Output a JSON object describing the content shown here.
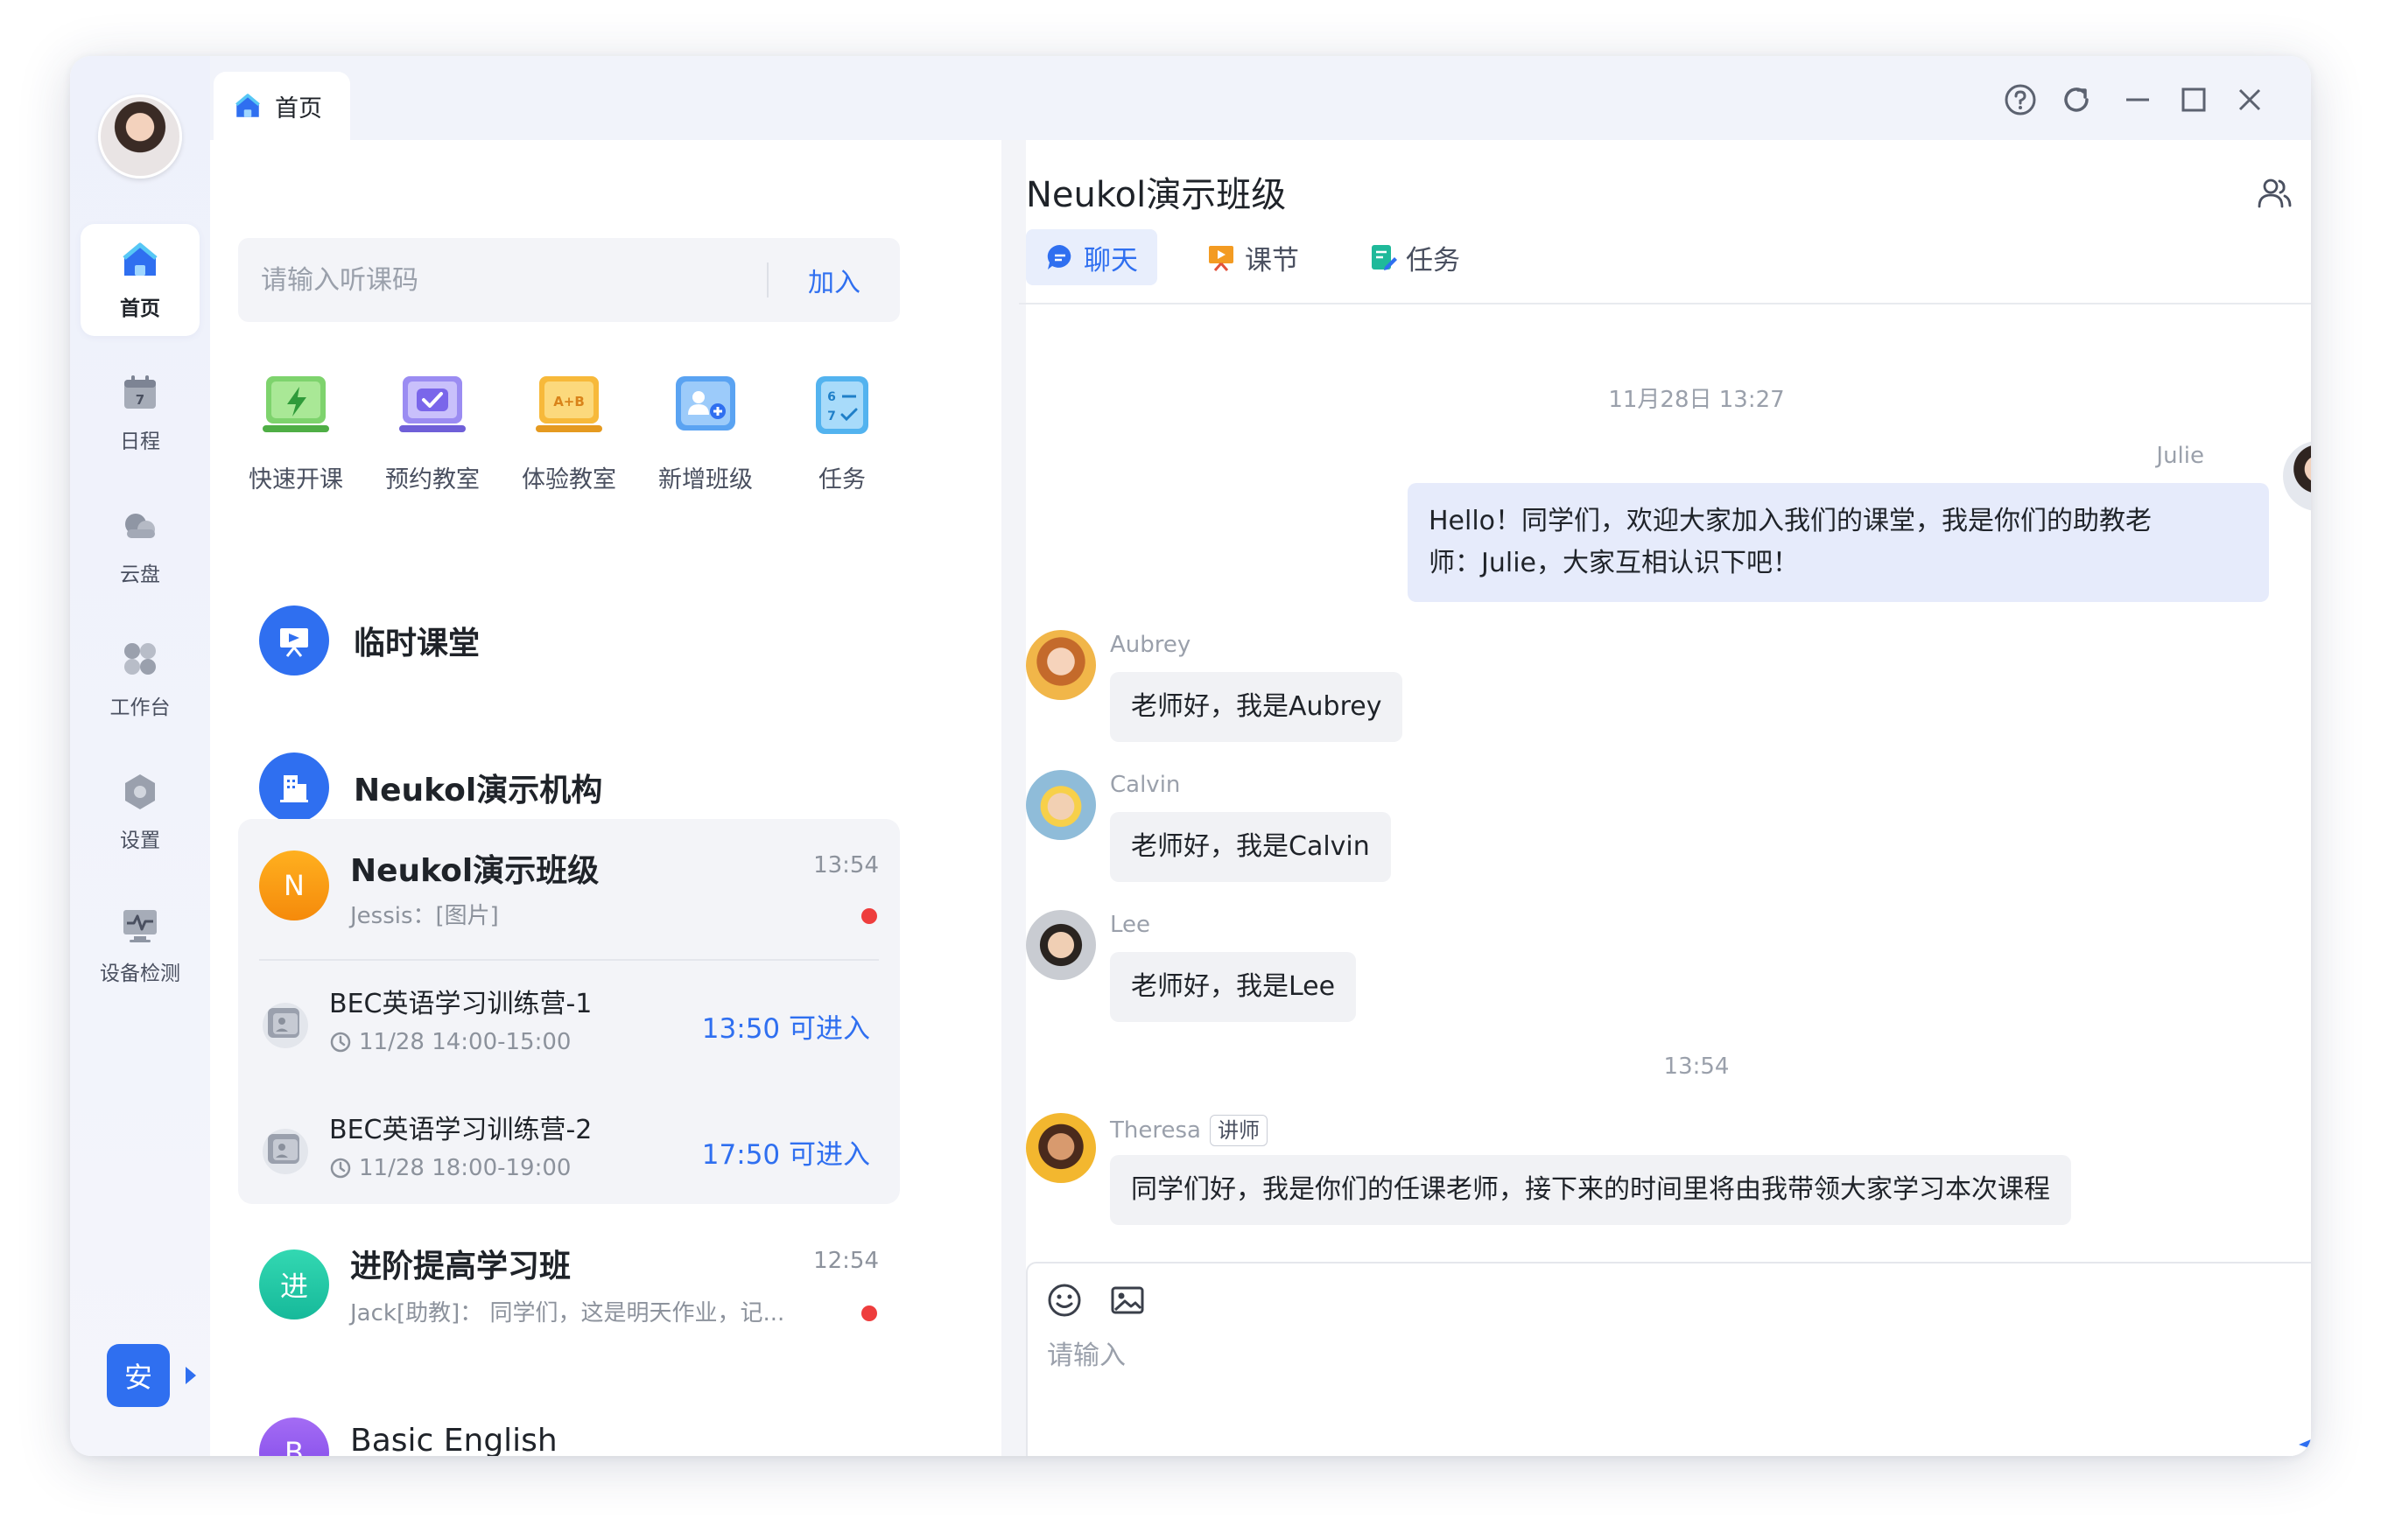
{
  "window": {
    "tab_label": "首页",
    "colors": {
      "primary": "#2f6ff0",
      "unread": "#ee3d3d"
    }
  },
  "rail": {
    "items": [
      {
        "label": "首页",
        "icon": "home-icon",
        "active": true
      },
      {
        "label": "日程",
        "icon": "calendar-icon",
        "day": "7"
      },
      {
        "label": "云盘",
        "icon": "cloud-icon"
      },
      {
        "label": "工作台",
        "icon": "workspace-icon"
      },
      {
        "label": "设置",
        "icon": "settings-icon"
      },
      {
        "label": "设备检测",
        "icon": "device-check-icon"
      }
    ],
    "user_badge": "安"
  },
  "search": {
    "placeholder": "请输入听课码",
    "join_label": "加入"
  },
  "quick_actions": [
    {
      "label": "快速开课",
      "icon": "quick-class-icon"
    },
    {
      "label": "预约教室",
      "icon": "book-classroom-icon"
    },
    {
      "label": "体验教室",
      "icon": "trial-classroom-icon",
      "badge": "A+B"
    },
    {
      "label": "新增班级",
      "icon": "add-class-icon"
    },
    {
      "label": "任务",
      "icon": "task-icon"
    }
  ],
  "rooms": {
    "temp": {
      "title": "临时课堂"
    },
    "org": {
      "title": "Neukol演示机构"
    }
  },
  "active_conversation": {
    "initial": "N",
    "name": "Neukol演示班级",
    "time": "13:54",
    "preview": "Jessis：[图片]",
    "sessions": [
      {
        "title": "BEC英语学习训练营-1",
        "time": "11/28 14:00-15:00",
        "enter": "13:50 可进入"
      },
      {
        "title": "BEC英语学习训练营-2",
        "time": "11/28 18:00-19:00",
        "enter": "17:50 可进入"
      }
    ]
  },
  "conversations": [
    {
      "initial": "进",
      "name": "进阶提高学习班",
      "time": "12:54",
      "preview": "Jack[助教]：  同学们，这是明天作业，记...",
      "unread": true
    },
    {
      "initial": "B",
      "name": "Basic English"
    }
  ],
  "chat": {
    "title": "Neukol演示班级",
    "tabs": [
      {
        "label": "聊天",
        "active": true
      },
      {
        "label": "课节"
      },
      {
        "label": "任务"
      }
    ],
    "stamps": [
      "11月28日 13:27",
      "13:54"
    ],
    "messages": [
      {
        "sender": "Julie",
        "text_line1": "Hello！同学们，欢迎大家加入我们的课堂，我是你们的助教老",
        "text_line2": "师：Julie，大家互相认识下吧！",
        "mine": true
      },
      {
        "sender": "Aubrey",
        "text": "老师好，我是Aubrey"
      },
      {
        "sender": "Calvin",
        "text": "老师好，我是Calvin"
      },
      {
        "sender": "Lee",
        "text": "老师好，我是Lee"
      },
      {
        "sender": "Theresa",
        "role": "讲师",
        "text": "同学们好，我是你们的任课老师，接下来的时间里将由我带领大家学习本次课程"
      }
    ],
    "composer_placeholder": "请输入"
  }
}
